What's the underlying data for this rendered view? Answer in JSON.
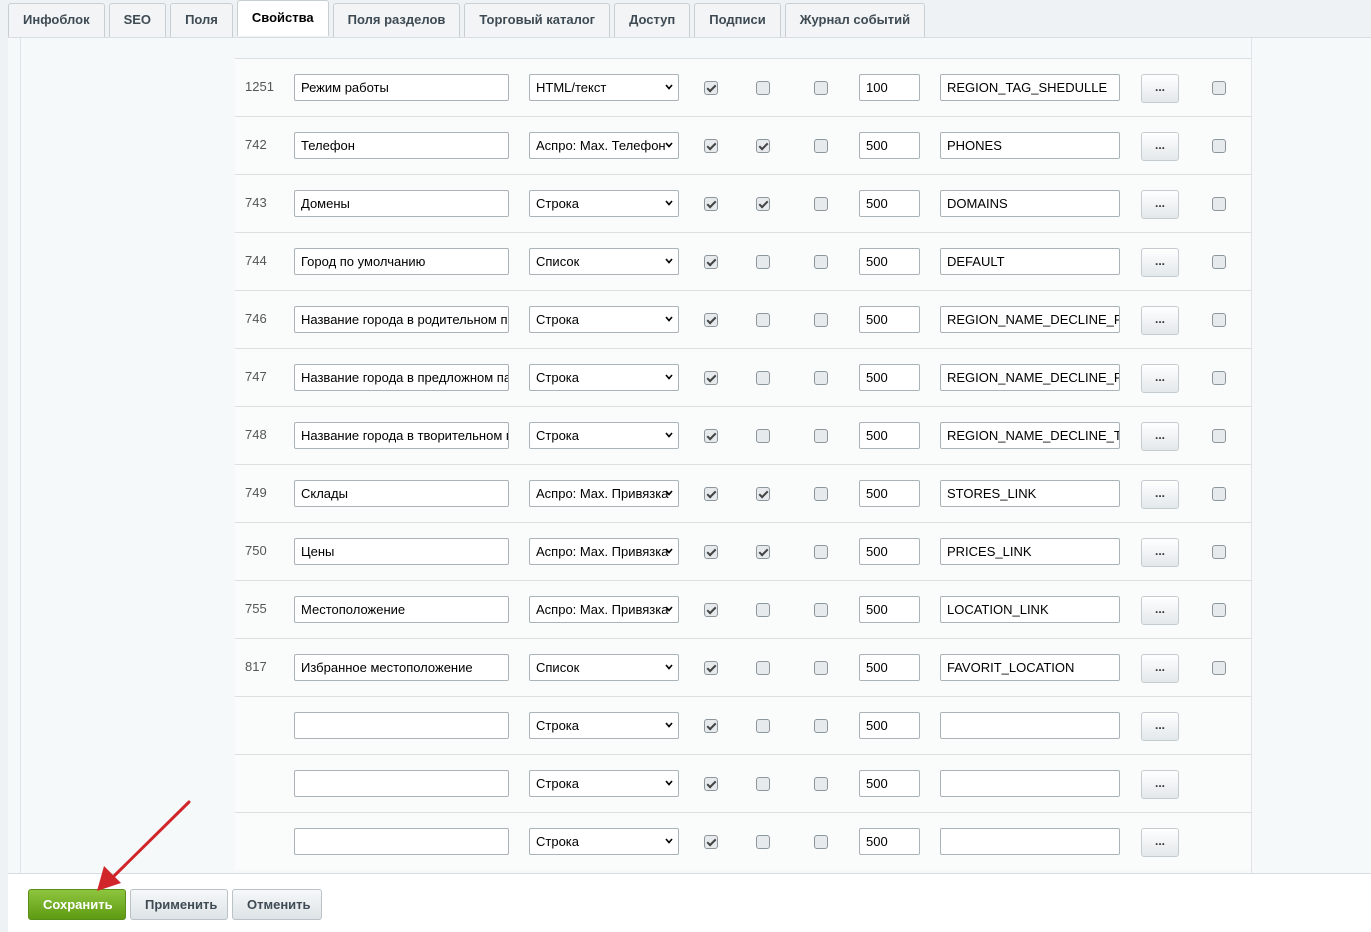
{
  "tabs": [
    {
      "label": "Инфоблок",
      "active": false
    },
    {
      "label": "SEO",
      "active": false
    },
    {
      "label": "Поля",
      "active": false
    },
    {
      "label": "Свойства",
      "active": true
    },
    {
      "label": "Поля разделов",
      "active": false
    },
    {
      "label": "Торговый каталог",
      "active": false
    },
    {
      "label": "Доступ",
      "active": false
    },
    {
      "label": "Подписи",
      "active": false
    },
    {
      "label": "Журнал событий",
      "active": false
    }
  ],
  "rows": [
    {
      "id": "1251",
      "name": "Режим работы",
      "type": "HTML/текст",
      "c1": true,
      "c2": false,
      "c3": false,
      "sort": "100",
      "code": "REGION_TAG_SHEDULLE",
      "del": true
    },
    {
      "id": "742",
      "name": "Телефон",
      "type": "Аспро: Max. Телефон",
      "c1": true,
      "c2": true,
      "c3": false,
      "sort": "500",
      "code": "PHONES",
      "del": true
    },
    {
      "id": "743",
      "name": "Домены",
      "type": "Строка",
      "c1": true,
      "c2": true,
      "c3": false,
      "sort": "500",
      "code": "DOMAINS",
      "del": true
    },
    {
      "id": "744",
      "name": "Город по умолчанию",
      "type": "Список",
      "c1": true,
      "c2": false,
      "c3": false,
      "sort": "500",
      "code": "DEFAULT",
      "del": true
    },
    {
      "id": "746",
      "name": "Название города в родительном падеже",
      "type": "Строка",
      "c1": true,
      "c2": false,
      "c3": false,
      "sort": "500",
      "code": "REGION_NAME_DECLINE_RP",
      "del": true
    },
    {
      "id": "747",
      "name": "Название города в предложном падеже",
      "type": "Строка",
      "c1": true,
      "c2": false,
      "c3": false,
      "sort": "500",
      "code": "REGION_NAME_DECLINE_PP",
      "del": true
    },
    {
      "id": "748",
      "name": "Название города в творительном падеже",
      "type": "Строка",
      "c1": true,
      "c2": false,
      "c3": false,
      "sort": "500",
      "code": "REGION_NAME_DECLINE_TP",
      "del": true
    },
    {
      "id": "749",
      "name": "Склады",
      "type": "Аспро: Max. Привязка",
      "c1": true,
      "c2": true,
      "c3": false,
      "sort": "500",
      "code": "STORES_LINK",
      "del": true
    },
    {
      "id": "750",
      "name": "Цены",
      "type": "Аспро: Max. Привязка",
      "c1": true,
      "c2": true,
      "c3": false,
      "sort": "500",
      "code": "PRICES_LINK",
      "del": true
    },
    {
      "id": "755",
      "name": "Местоположение",
      "type": "Аспро: Max. Привязка",
      "c1": true,
      "c2": false,
      "c3": false,
      "sort": "500",
      "code": "LOCATION_LINK",
      "del": true
    },
    {
      "id": "817",
      "name": "Избранное местоположение",
      "type": "Список",
      "c1": true,
      "c2": false,
      "c3": false,
      "sort": "500",
      "code": "FAVORIT_LOCATION",
      "del": true
    },
    {
      "id": "",
      "name": "",
      "type": "Строка",
      "c1": true,
      "c2": false,
      "c3": false,
      "sort": "500",
      "code": "",
      "del": null
    },
    {
      "id": "",
      "name": "",
      "type": "Строка",
      "c1": true,
      "c2": false,
      "c3": false,
      "sort": "500",
      "code": "",
      "del": null
    },
    {
      "id": "",
      "name": "",
      "type": "Строка",
      "c1": true,
      "c2": false,
      "c3": false,
      "sort": "500",
      "code": "",
      "del": null
    }
  ],
  "settings_button_label": "...",
  "footer": {
    "save_label": "Сохранить",
    "apply_label": "Применить",
    "cancel_label": "Отменить"
  },
  "colors": {
    "accent": "#6fab1f",
    "annotation_arrow": "#d0262b"
  }
}
